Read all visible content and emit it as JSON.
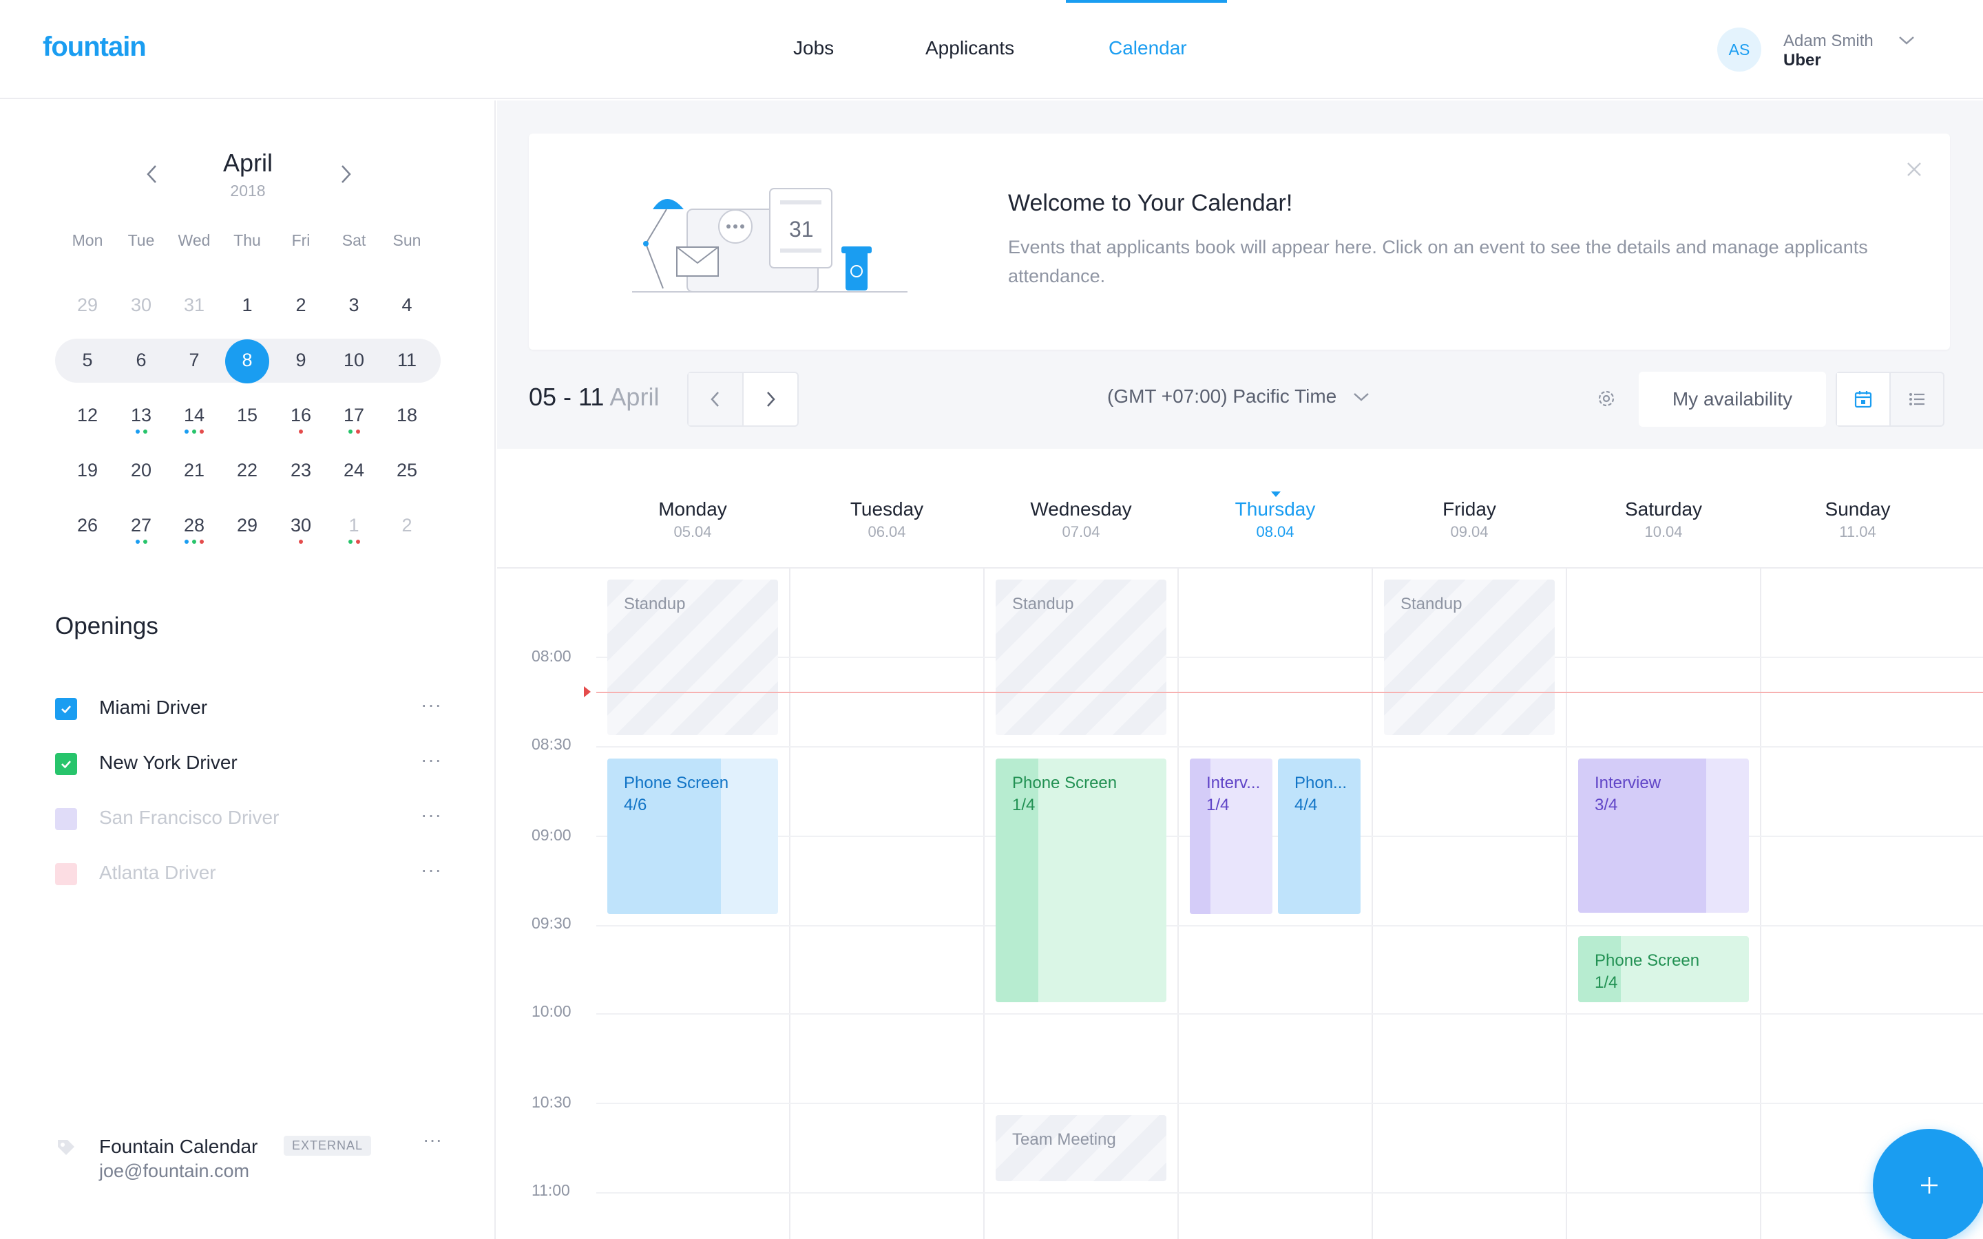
{
  "brand": {
    "logo": "fountain",
    "accent": "#1a9df1"
  },
  "nav": {
    "tabs": [
      {
        "label": "Jobs"
      },
      {
        "label": "Applicants"
      },
      {
        "label": "Calendar",
        "active": true
      }
    ]
  },
  "user": {
    "initials": "AS",
    "name": "Adam Smith",
    "org": "Uber"
  },
  "mini_calendar": {
    "month": "April",
    "year": "2018",
    "weekdays": [
      "Mon",
      "Tue",
      "Wed",
      "Thu",
      "Fri",
      "Sat",
      "Sun"
    ],
    "weeks": [
      [
        "29",
        "30",
        "31",
        "1",
        "2",
        "3",
        "4"
      ],
      [
        "5",
        "6",
        "7",
        "8",
        "9",
        "10",
        "11"
      ],
      [
        "12",
        "13",
        "14",
        "15",
        "16",
        "17",
        "18"
      ],
      [
        "19",
        "20",
        "21",
        "22",
        "23",
        "24",
        "25"
      ],
      [
        "26",
        "27",
        "28",
        "29",
        "30",
        "1",
        "2"
      ]
    ],
    "selected_day": "8"
  },
  "openings": {
    "title": "Openings",
    "items": [
      {
        "label": "Miami Driver",
        "checked": true,
        "color": "#1a9df1"
      },
      {
        "label": "New York Driver",
        "checked": true,
        "color": "#27c46b"
      },
      {
        "label": "San Francisco Driver",
        "checked": false,
        "color": "#e0dcf8"
      },
      {
        "label": "Atlanta Driver",
        "checked": false,
        "color": "#fcdde3"
      }
    ],
    "more_label": "···"
  },
  "external_calendar": {
    "name": "Fountain Calendar",
    "badge": "EXTERNAL",
    "email": "joe@fountain.com"
  },
  "welcome": {
    "title": "Welcome to Your Calendar!",
    "text": "Events that  applicants book will appear here. Click on an event to see the details and manage applicants attendance.",
    "illustration_date": "31"
  },
  "toolbar": {
    "range_strong": "05 - 11",
    "range_month": "April",
    "timezone": "(GMT +07:00) Pacific Time",
    "availability_button": "My availability"
  },
  "week": {
    "days": [
      {
        "name": "Monday",
        "date": "05.04"
      },
      {
        "name": "Tuesday",
        "date": "06.04"
      },
      {
        "name": "Wednesday",
        "date": "07.04"
      },
      {
        "name": "Thursday",
        "date": "08.04",
        "today": true
      },
      {
        "name": "Friday",
        "date": "09.04"
      },
      {
        "name": "Saturday",
        "date": "10.04"
      },
      {
        "name": "Sunday",
        "date": "11.04"
      }
    ],
    "times": [
      "08:00",
      "08:30",
      "09:00",
      "09:30",
      "10:00",
      "10:30",
      "11:00"
    ]
  },
  "events": {
    "standup_mon": {
      "title": "Standup"
    },
    "standup_wed": {
      "title": "Standup"
    },
    "standup_fri": {
      "title": "Standup"
    },
    "phone_mon": {
      "title": "Phone Screen",
      "count": "4/6",
      "fill_fraction": 0.667
    },
    "phone_wed": {
      "title": "Phone Screen",
      "count": "1/4",
      "fill_fraction": 0.25
    },
    "interview_thu": {
      "title": "Interv...",
      "count": "1/4",
      "fill_fraction": 0.25
    },
    "phone_thu": {
      "title": "Phon...",
      "count": "4/4",
      "fill_fraction": 1.0
    },
    "interview_sat": {
      "title": "Interview",
      "count": "3/4",
      "fill_fraction": 0.75
    },
    "phone_sat": {
      "title": "Phone Screen",
      "count": "1/4",
      "fill_fraction": 0.25
    },
    "team_meeting_wed": {
      "title": "Team Meeting"
    }
  }
}
